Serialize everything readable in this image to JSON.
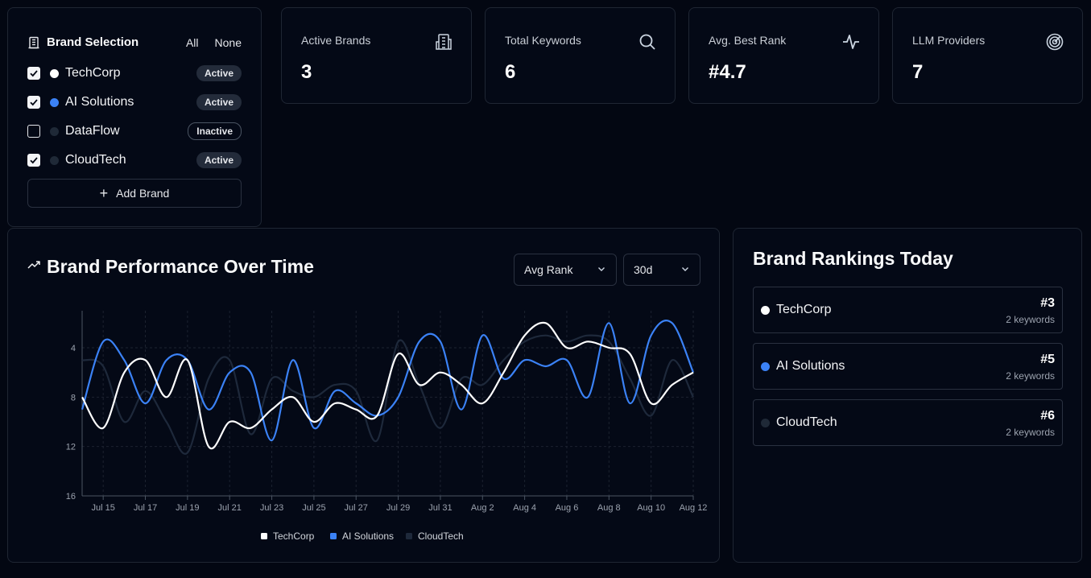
{
  "brand_selection": {
    "title": "Brand Selection",
    "all_label": "All",
    "none_label": "None",
    "brands": [
      {
        "name": "TechCorp",
        "checked": true,
        "color": "#ffffff",
        "status": "Active"
      },
      {
        "name": "AI Solutions",
        "checked": true,
        "color": "#3b82f6",
        "status": "Active"
      },
      {
        "name": "DataFlow",
        "checked": false,
        "color": "#1f2937",
        "status": "Inactive"
      },
      {
        "name": "CloudTech",
        "checked": true,
        "color": "#1f2937",
        "status": "Active"
      }
    ],
    "add_label": "Add Brand"
  },
  "stats": [
    {
      "label": "Active Brands",
      "value": "3",
      "icon": "building-icon"
    },
    {
      "label": "Total Keywords",
      "value": "6",
      "icon": "search-icon"
    },
    {
      "label": "Avg. Best Rank",
      "value": "#4.7",
      "icon": "activity-icon"
    },
    {
      "label": "LLM Providers",
      "value": "7",
      "icon": "radar-icon"
    }
  ],
  "performance": {
    "title": "Brand Performance Over Time",
    "metric_select": "Avg Rank",
    "range_select": "30d"
  },
  "rankings": {
    "title": "Brand Rankings Today",
    "rows": [
      {
        "name": "TechCorp",
        "rank": "#3",
        "keywords": "2 keywords",
        "color": "#ffffff"
      },
      {
        "name": "AI Solutions",
        "rank": "#5",
        "keywords": "2 keywords",
        "color": "#3b82f6"
      },
      {
        "name": "CloudTech",
        "rank": "#6",
        "keywords": "2 keywords",
        "color": "#1f2937"
      }
    ]
  },
  "chart_data": {
    "type": "line",
    "x_labels": [
      "Jul 15",
      "Jul 17",
      "Jul 19",
      "Jul 21",
      "Jul 23",
      "Jul 25",
      "Jul 27",
      "Jul 29",
      "Jul 31",
      "Aug 2",
      "Aug 4",
      "Aug 6",
      "Aug 8",
      "Aug 10",
      "Aug 12"
    ],
    "x_dates": [
      "Jul 14",
      "Jul 15",
      "Jul 16",
      "Jul 17",
      "Jul 18",
      "Jul 19",
      "Jul 20",
      "Jul 21",
      "Jul 22",
      "Jul 23",
      "Jul 24",
      "Jul 25",
      "Jul 26",
      "Jul 27",
      "Jul 28",
      "Jul 29",
      "Jul 30",
      "Jul 31",
      "Aug 1",
      "Aug 2",
      "Aug 3",
      "Aug 4",
      "Aug 5",
      "Aug 6",
      "Aug 7",
      "Aug 8",
      "Aug 9",
      "Aug 10",
      "Aug 11",
      "Aug 12"
    ],
    "y_ticks": [
      4,
      8,
      12,
      16
    ],
    "ylim": [
      16,
      1
    ],
    "y_reversed": true,
    "grid": true,
    "legend_position": "bottom",
    "series": [
      {
        "name": "TechCorp",
        "color": "#ffffff",
        "values": [
          8,
          10.5,
          6,
          5,
          8,
          5,
          12,
          10,
          10.5,
          9,
          8,
          10,
          8.5,
          9,
          9.5,
          4.5,
          7,
          6,
          7,
          8.5,
          6,
          3,
          2,
          4,
          3.5,
          4,
          4.5,
          8.5,
          7,
          6
        ]
      },
      {
        "name": "AI Solutions",
        "color": "#3b82f6",
        "values": [
          9,
          3.5,
          5,
          8.5,
          5,
          5,
          9,
          6,
          6,
          11.5,
          5,
          10.5,
          7.5,
          8.5,
          9.5,
          8,
          3.5,
          3.5,
          9,
          3,
          6.5,
          5,
          5.5,
          5,
          8,
          2,
          8.5,
          3,
          2,
          6
        ]
      },
      {
        "name": "CloudTech",
        "color": "#1e293b",
        "values": [
          5,
          5.5,
          10,
          7.5,
          10,
          12.5,
          6.5,
          5,
          11,
          6.5,
          7.5,
          8,
          7,
          7.5,
          11.5,
          3.5,
          7,
          10.5,
          6.5,
          7,
          5,
          3.5,
          3,
          3.5,
          3,
          3.5,
          6.5,
          9.5,
          5,
          8
        ]
      }
    ]
  }
}
